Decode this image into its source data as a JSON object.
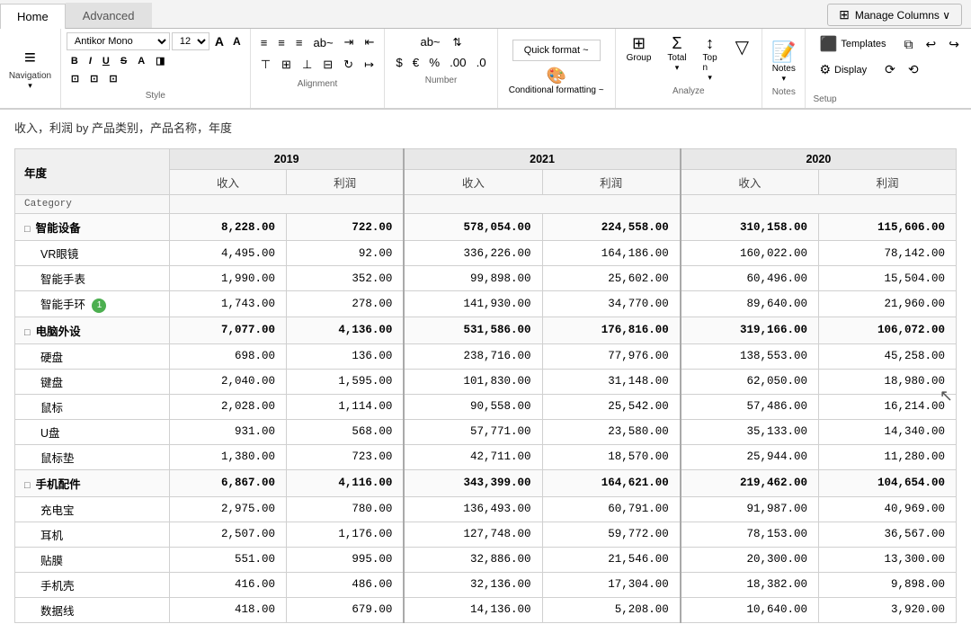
{
  "tabs": [
    {
      "label": "Home",
      "active": true
    },
    {
      "label": "Advanced",
      "active": false
    }
  ],
  "manage_columns_btn": "Manage Columns ∨",
  "ribbon": {
    "navigation": {
      "label": "Navigation",
      "icon": "≡"
    },
    "style": {
      "font": "Antikor Mono",
      "size": "12",
      "label": "Style"
    },
    "alignment": {
      "label": "Alignment"
    },
    "number": {
      "label": "Number",
      "ab_label": "ab~",
      "symbols": [
        "$",
        "€",
        "%",
        ".00",
        ".0"
      ]
    },
    "quick_format": {
      "label": "Quick format ~"
    },
    "analyze": {
      "label": "Analyze",
      "items": [
        {
          "icon": "⊞",
          "label": "Group"
        },
        {
          "icon": "Σ",
          "label": "Total"
        },
        {
          "icon": "↑↓",
          "label": "Top n"
        }
      ]
    },
    "conditional_formatting": {
      "label": "Conditional formatting ~",
      "icon": "🎨"
    },
    "filter": {
      "icon": "▽"
    },
    "notes": {
      "label": "Notes",
      "icon": "📝"
    },
    "setup": {
      "label": "Setup",
      "templates": "Templates",
      "display": "Display"
    }
  },
  "breadcrumb": "收入，利润 by 产品类别，产品名称，年度",
  "table": {
    "year_label": "年度",
    "years": [
      "2019",
      "2021",
      "2020"
    ],
    "col_headers": [
      "收入",
      "利润"
    ],
    "category_col": "Category",
    "rows": [
      {
        "type": "category",
        "label": "智能设备",
        "expandable": true,
        "values": [
          [
            "8,228.00",
            "722.00"
          ],
          [
            "578,054.00",
            "224,558.00"
          ],
          [
            "310,158.00",
            "115,606.00"
          ]
        ],
        "children": [
          {
            "label": "VR眼镜",
            "badge": null,
            "values": [
              [
                "4,495.00",
                "92.00"
              ],
              [
                "336,226.00",
                "164,186.00"
              ],
              [
                "160,022.00",
                "78,142.00"
              ]
            ]
          },
          {
            "label": "智能手表",
            "badge": null,
            "values": [
              [
                "1,990.00",
                "352.00"
              ],
              [
                "99,898.00",
                "25,602.00"
              ],
              [
                "60,496.00",
                "15,504.00"
              ]
            ]
          },
          {
            "label": "智能手环",
            "badge": 1,
            "values": [
              [
                "1,743.00",
                "278.00"
              ],
              [
                "141,930.00",
                "34,770.00"
              ],
              [
                "89,640.00",
                "21,960.00"
              ]
            ]
          }
        ]
      },
      {
        "type": "category",
        "label": "电脑外设",
        "expandable": true,
        "values": [
          [
            "7,077.00",
            "4,136.00"
          ],
          [
            "531,586.00",
            "176,816.00"
          ],
          [
            "319,166.00",
            "106,072.00"
          ]
        ],
        "children": [
          {
            "label": "硬盘",
            "badge": null,
            "values": [
              [
                "698.00",
                "136.00"
              ],
              [
                "238,716.00",
                "77,976.00"
              ],
              [
                "138,553.00",
                "45,258.00"
              ]
            ]
          },
          {
            "label": "键盘",
            "badge": null,
            "values": [
              [
                "2,040.00",
                "1,595.00"
              ],
              [
                "101,830.00",
                "31,148.00"
              ],
              [
                "62,050.00",
                "18,980.00"
              ]
            ]
          },
          {
            "label": "鼠标",
            "badge": null,
            "values": [
              [
                "2,028.00",
                "1,114.00"
              ],
              [
                "90,558.00",
                "25,542.00"
              ],
              [
                "57,486.00",
                "16,214.00"
              ]
            ]
          },
          {
            "label": "U盘",
            "badge": null,
            "values": [
              [
                "931.00",
                "568.00"
              ],
              [
                "57,771.00",
                "23,580.00"
              ],
              [
                "35,133.00",
                "14,340.00"
              ]
            ]
          },
          {
            "label": "鼠标垫",
            "badge": null,
            "values": [
              [
                "1,380.00",
                "723.00"
              ],
              [
                "42,711.00",
                "18,570.00"
              ],
              [
                "25,944.00",
                "11,280.00"
              ]
            ]
          }
        ]
      },
      {
        "type": "category",
        "label": "手机配件",
        "expandable": true,
        "values": [
          [
            "6,867.00",
            "4,116.00"
          ],
          [
            "343,399.00",
            "164,621.00"
          ],
          [
            "219,462.00",
            "104,654.00"
          ]
        ],
        "children": [
          {
            "label": "充电宝",
            "badge": null,
            "values": [
              [
                "2,975.00",
                "780.00"
              ],
              [
                "136,493.00",
                "60,791.00"
              ],
              [
                "91,987.00",
                "40,969.00"
              ]
            ]
          },
          {
            "label": "耳机",
            "badge": null,
            "values": [
              [
                "2,507.00",
                "1,176.00"
              ],
              [
                "127,748.00",
                "59,772.00"
              ],
              [
                "78,153.00",
                "36,567.00"
              ]
            ]
          },
          {
            "label": "贴膜",
            "badge": null,
            "values": [
              [
                "551.00",
                "995.00"
              ],
              [
                "32,886.00",
                "21,546.00"
              ],
              [
                "20,300.00",
                "13,300.00"
              ]
            ]
          },
          {
            "label": "手机壳",
            "badge": null,
            "values": [
              [
                "416.00",
                "486.00"
              ],
              [
                "32,136.00",
                "17,304.00"
              ],
              [
                "18,382.00",
                "9,898.00"
              ]
            ]
          },
          {
            "label": "数据线",
            "badge": null,
            "values": [
              [
                "418.00",
                "679.00"
              ],
              [
                "14,136.00",
                "5,208.00"
              ],
              [
                "10,640.00",
                "3,920.00"
              ]
            ]
          }
        ]
      }
    ]
  }
}
